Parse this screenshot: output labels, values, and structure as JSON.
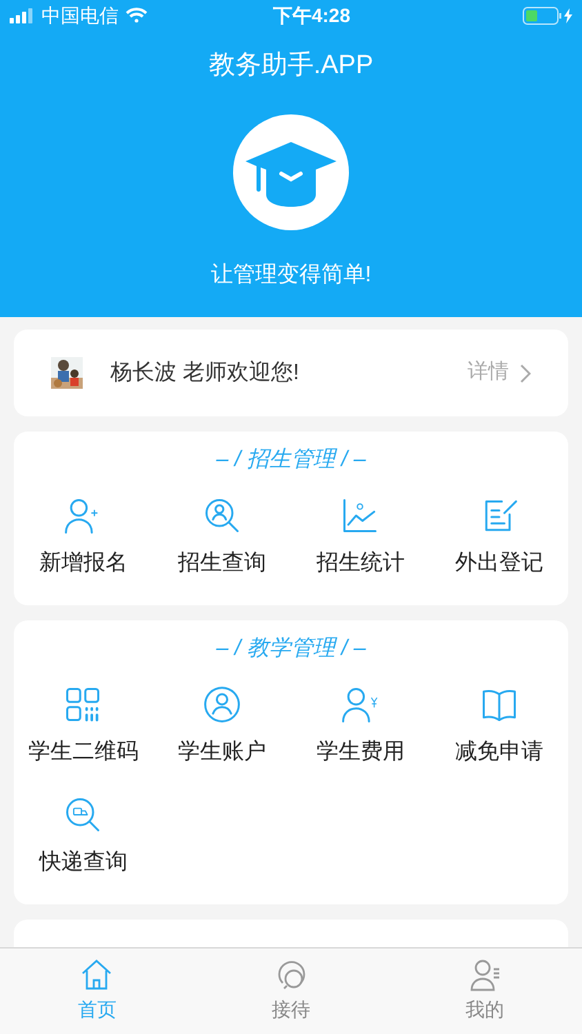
{
  "status_bar": {
    "carrier": "中国电信",
    "time": "下午4:28"
  },
  "header": {
    "title": "教务助手.APP",
    "slogan": "让管理变得简单!"
  },
  "welcome": {
    "name": "杨长波",
    "greeting": "老师欢迎您!",
    "details": "详情"
  },
  "sections": [
    {
      "title": "– / 招生管理 / –",
      "items": [
        "新增报名",
        "招生查询",
        "招生统计",
        "外出登记"
      ]
    },
    {
      "title": "– / 教学管理 / –",
      "items": [
        "学生二维码",
        "学生账户",
        "学生费用",
        "减免申请",
        "快递查询"
      ]
    }
  ],
  "tab_bar": [
    {
      "label": "首页",
      "selected": true
    },
    {
      "label": "接待",
      "selected": false
    },
    {
      "label": "我的",
      "selected": false
    }
  ]
}
